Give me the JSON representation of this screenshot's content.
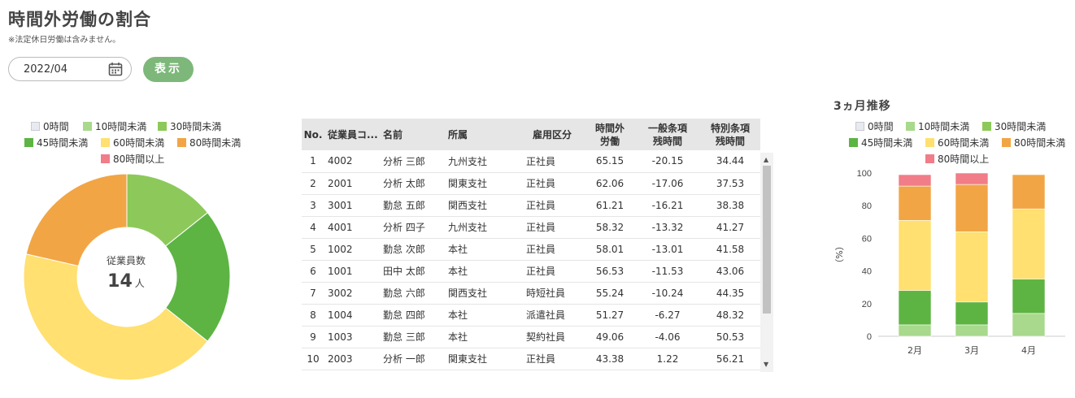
{
  "header": {
    "title": "時間外労働の割合",
    "note": "※法定休日労働は含みません。"
  },
  "filter": {
    "date_value": "2022/04",
    "show_button": "表示"
  },
  "categories": [
    {
      "label": "0時間",
      "color": "#e8eaf0"
    },
    {
      "label": "10時間未満",
      "color": "#a8d98c"
    },
    {
      "label": "30時間未満",
      "color": "#8cc95a"
    },
    {
      "label": "45時間未満",
      "color": "#5db443"
    },
    {
      "label": "60時間未満",
      "color": "#ffe070"
    },
    {
      "label": "80時間未満",
      "color": "#f2a545"
    },
    {
      "label": "80時間以上",
      "color": "#f07d88"
    }
  ],
  "donut": {
    "label": "従業員数",
    "count": "14",
    "unit": "人",
    "values": [
      0,
      0,
      2,
      3,
      6,
      3,
      0
    ]
  },
  "table": {
    "headers": [
      "No.",
      "従業員コ...",
      "名前",
      "所属",
      "雇用区分",
      "時間外\n労働",
      "一般条項\n残時間",
      "特別条項\n残時間"
    ],
    "rows": [
      [
        "1",
        "4002",
        "分析 三郎",
        "九州支社",
        "正社員",
        "65.15",
        "-20.15",
        "34.44"
      ],
      [
        "2",
        "2001",
        "分析 太郎",
        "関東支社",
        "正社員",
        "62.06",
        "-17.06",
        "37.53"
      ],
      [
        "3",
        "3001",
        "勤怠 五郎",
        "関西支社",
        "正社員",
        "61.21",
        "-16.21",
        "38.38"
      ],
      [
        "4",
        "4001",
        "分析 四子",
        "九州支社",
        "正社員",
        "58.32",
        "-13.32",
        "41.27"
      ],
      [
        "5",
        "1002",
        "勤怠 次郎",
        "本社",
        "正社員",
        "58.01",
        "-13.01",
        "41.58"
      ],
      [
        "6",
        "1001",
        "田中 太郎",
        "本社",
        "正社員",
        "56.53",
        "-11.53",
        "43.06"
      ],
      [
        "7",
        "3002",
        "勤怠 六郎",
        "関西支社",
        "時短社員",
        "55.24",
        "-10.24",
        "44.35"
      ],
      [
        "8",
        "1004",
        "勤怠 四郎",
        "本社",
        "派遣社員",
        "51.27",
        "-6.27",
        "48.32"
      ],
      [
        "9",
        "1003",
        "勤怠 三郎",
        "本社",
        "契約社員",
        "49.06",
        "-4.06",
        "50.53"
      ],
      [
        "10",
        "2003",
        "分析 一郎",
        "関東支社",
        "正社員",
        "43.38",
        "1.22",
        "56.21"
      ]
    ]
  },
  "trend": {
    "title": "3ヵ月推移"
  },
  "chart_data": {
    "type": "bar",
    "stacked": true,
    "title": "3ヵ月推移",
    "categories": [
      "2月",
      "3月",
      "4月"
    ],
    "ylabel": "（%）",
    "ylim": [
      0,
      100
    ],
    "yticks": [
      0,
      20,
      40,
      60,
      80,
      100
    ],
    "series": [
      {
        "name": "0時間",
        "values": [
          0,
          0,
          0
        ]
      },
      {
        "name": "10時間未満",
        "values": [
          7,
          7,
          14
        ]
      },
      {
        "name": "30時間未満",
        "values": [
          0,
          0,
          0
        ]
      },
      {
        "name": "45時間未満",
        "values": [
          21,
          14,
          21
        ]
      },
      {
        "name": "60時間未満",
        "values": [
          43,
          43,
          43
        ]
      },
      {
        "name": "80時間未満",
        "values": [
          21,
          29,
          21
        ]
      },
      {
        "name": "80時間以上",
        "values": [
          7,
          7,
          0
        ]
      }
    ]
  }
}
